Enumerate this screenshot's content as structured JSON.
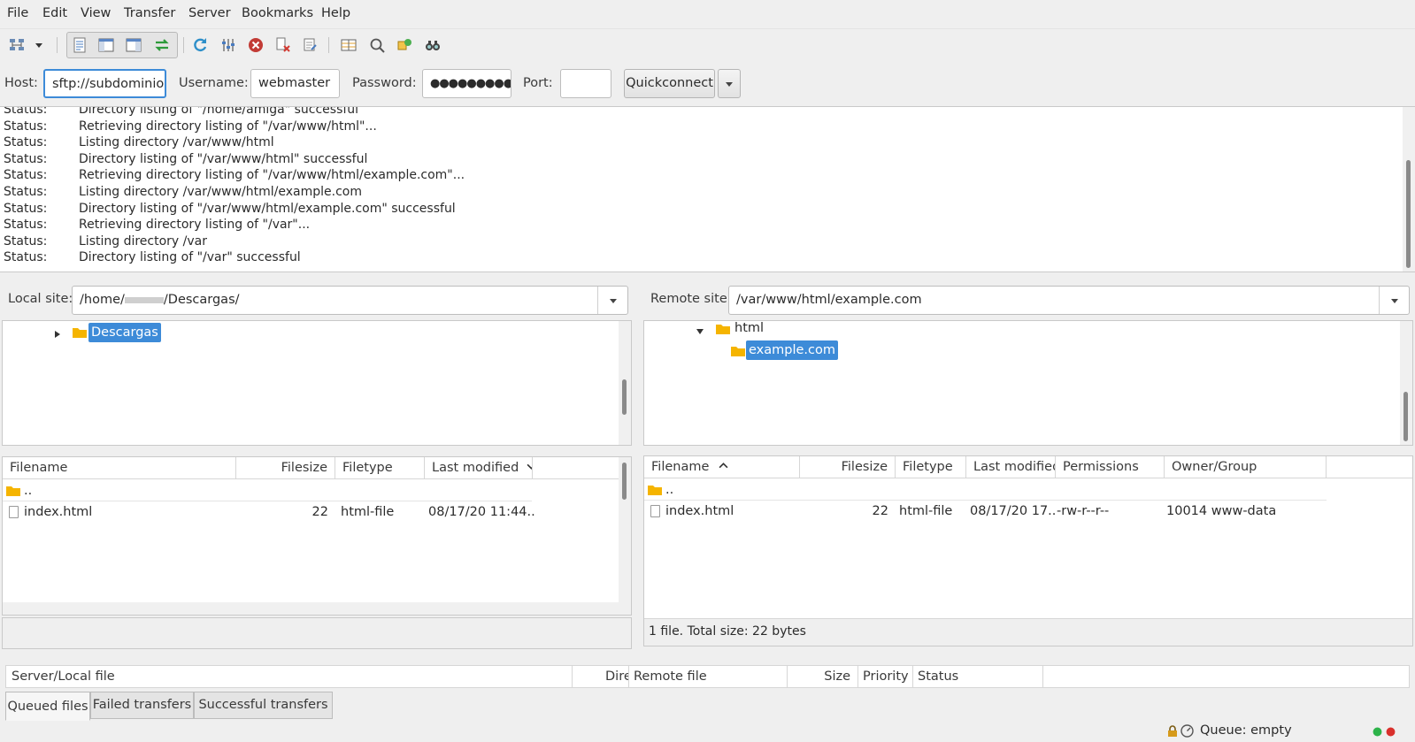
{
  "menu": [
    "File",
    "Edit",
    "View",
    "Transfer",
    "Server",
    "Bookmarks",
    "Help"
  ],
  "toolbar": {
    "icons": [
      "site-manager-icon",
      "dropdown-arrow-icon",
      "message-log-icon",
      "local-tree-icon",
      "remote-tree-icon",
      "transfer-queue-icon",
      "refresh-icon",
      "process-queue-icon",
      "cancel-icon",
      "disconnect-icon",
      "reconnect-icon",
      "directory-comparison-icon",
      "filter-icon",
      "sync-browse-icon",
      "search-icon"
    ]
  },
  "quickconnect": {
    "host_label": "Host:",
    "host_value": "sftp://subdominio.n",
    "username_label": "Username:",
    "username_value": "webmaster",
    "password_label": "Password:",
    "password_value": "●●●●●●●●●",
    "port_label": "Port:",
    "port_value": "",
    "button_label": "Quickconnect"
  },
  "log": [
    {
      "k": "Status:",
      "v": "Directory listing of \"/home/amiga\" successful"
    },
    {
      "k": "Status:",
      "v": "Retrieving directory listing of \"/var/www/html\"..."
    },
    {
      "k": "Status:",
      "v": "Listing directory /var/www/html"
    },
    {
      "k": "Status:",
      "v": "Directory listing of \"/var/www/html\" successful"
    },
    {
      "k": "Status:",
      "v": "Retrieving directory listing of \"/var/www/html/example.com\"..."
    },
    {
      "k": "Status:",
      "v": "Listing directory /var/www/html/example.com"
    },
    {
      "k": "Status:",
      "v": "Directory listing of \"/var/www/html/example.com\" successful"
    },
    {
      "k": "Status:",
      "v": "Retrieving directory listing of \"/var\"..."
    },
    {
      "k": "Status:",
      "v": "Listing directory /var"
    },
    {
      "k": "Status:",
      "v": "Directory listing of \"/var\" successful"
    }
  ],
  "local": {
    "site_label": "Local site:",
    "path_prefix": "/home/",
    "path_suffix": "/Descargas/",
    "tree_node": "Descargas",
    "headers": [
      "Filename",
      "Filesize",
      "Filetype",
      "Last modified"
    ],
    "rows": [
      {
        "name": "..",
        "size": "",
        "type": "",
        "modified": ""
      },
      {
        "name": "index.html",
        "size": "22",
        "type": "html-file",
        "modified": "08/17/20 11:44..."
      }
    ]
  },
  "remote": {
    "site_label": "Remote site:",
    "path": "/var/www/html/example.com",
    "tree_parent": "html",
    "tree_node": "example.com",
    "headers": [
      "Filename",
      "Filesize",
      "Filetype",
      "Last modified",
      "Permissions",
      "Owner/Group"
    ],
    "rows": [
      {
        "name": "..",
        "size": "",
        "type": "",
        "modified": "",
        "perms": "",
        "owner": ""
      },
      {
        "name": "index.html",
        "size": "22",
        "type": "html-file",
        "modified": "08/17/20 17...",
        "perms": "-rw-r--r--",
        "owner": "10014 www-data"
      }
    ],
    "summary": "1 file. Total size: 22 bytes"
  },
  "queue": {
    "headers": [
      "Server/Local file",
      "Directio",
      "Remote file",
      "Size",
      "Priority",
      "Status"
    ],
    "tabs": [
      "Queued files",
      "Failed transfers",
      "Successful transfers"
    ],
    "status": "Queue: empty"
  },
  "colors": {
    "accent": "#3d8bd8",
    "folder": "#f5b400",
    "led_green": "#2db34a",
    "led_red": "#d9302c"
  }
}
